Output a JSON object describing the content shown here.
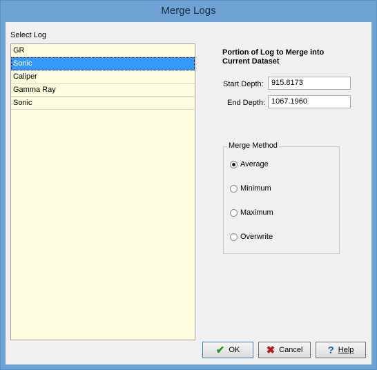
{
  "window": {
    "title": "Merge Logs"
  },
  "select_log": {
    "label": "Select Log",
    "items": [
      {
        "label": "GR",
        "selected": false
      },
      {
        "label": "Sonic",
        "selected": true
      },
      {
        "label": "Caliper",
        "selected": false
      },
      {
        "label": "Gamma Ray",
        "selected": false
      },
      {
        "label": "Sonic",
        "selected": false
      }
    ]
  },
  "portion": {
    "heading": "Portion of Log to Merge into Current Dataset",
    "start_label": "Start Depth:",
    "start_value": "915.8173",
    "end_label": "End Depth:",
    "end_value": "1067.1960"
  },
  "merge_method": {
    "legend": "Merge Method",
    "options": [
      {
        "label": "Average",
        "checked": true
      },
      {
        "label": "Minimum",
        "checked": false
      },
      {
        "label": "Maximum",
        "checked": false
      },
      {
        "label": "Overwrite",
        "checked": false
      }
    ]
  },
  "buttons": {
    "ok": "OK",
    "cancel": "Cancel",
    "help": "Help",
    "ok_icon": "checkmark-icon",
    "cancel_icon": "x-icon",
    "help_icon": "question-icon"
  },
  "colors": {
    "title_bar": "#6fa3d6",
    "list_background": "#fffde0",
    "selection": "#3399ff",
    "ok_icon": "#1e9a1e",
    "cancel_icon": "#b31a1a",
    "help_icon": "#1f5fbf"
  }
}
